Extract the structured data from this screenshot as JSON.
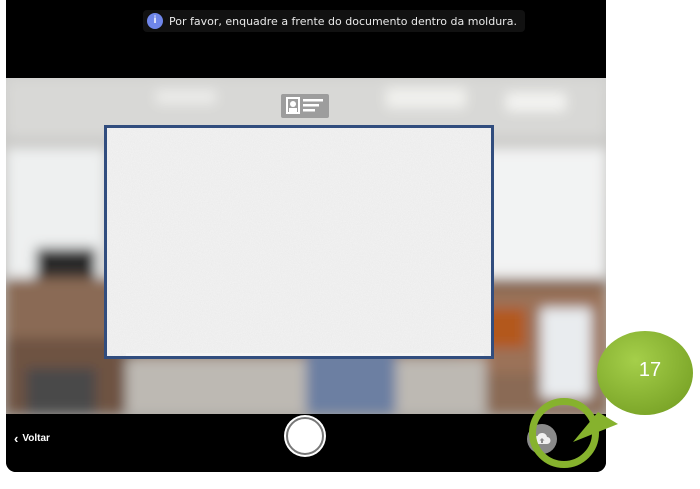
{
  "top_bar": {
    "hint_icon": "info-icon",
    "hint_icon_glyph": "i",
    "hint_text": "Por favor, enquadre a frente do documento dentro da moldura."
  },
  "camera": {
    "document_type_icon": "id-card-icon",
    "frame_icon": "document-frame"
  },
  "bottom_bar": {
    "back_icon": "chevron-left-icon",
    "back_label": "Voltar",
    "shutter_icon": "shutter-button",
    "upload_icon": "cloud-upload-icon"
  },
  "annotation": {
    "number": "17",
    "color": "#86b22d"
  }
}
